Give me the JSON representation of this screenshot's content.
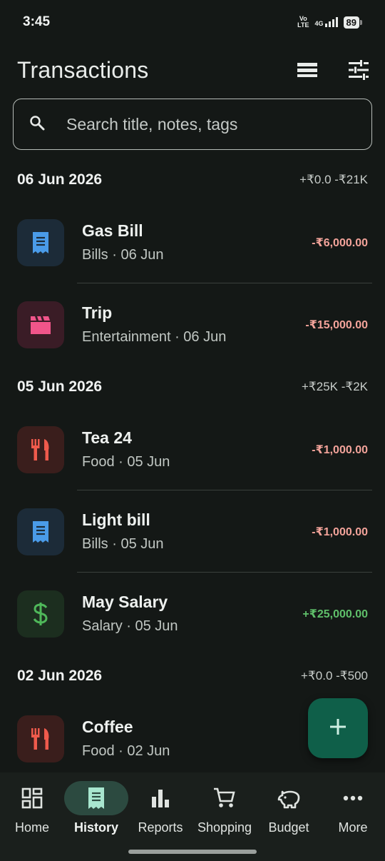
{
  "status": {
    "time": "3:45",
    "volte_top": "Vo",
    "volte_bottom": "LTE",
    "network": "4G",
    "battery": "89"
  },
  "header": {
    "title": "Transactions",
    "icons": [
      "view-list-icon",
      "filter-tune-icon"
    ]
  },
  "search": {
    "placeholder": "Search title, notes, tags",
    "value": ""
  },
  "groups": [
    {
      "date": "06 Jun 2026",
      "totals": "+₹0.0  -₹21K",
      "items": [
        {
          "title": "Gas Bill",
          "subtitle": "Bills · 06 Jun",
          "amount": "-₹6,000.00",
          "icon": "receipt-icon",
          "kind": "expense",
          "icon_color": "#4a9be8",
          "icon_bg": "#1c2b38"
        },
        {
          "title": "Trip",
          "subtitle": "Entertainment · 06 Jun",
          "amount": "-₹15,000.00",
          "icon": "clapperboard-icon",
          "kind": "expense",
          "icon_color": "#f0558a",
          "icon_bg": "#3a1c26"
        }
      ]
    },
    {
      "date": "05 Jun 2026",
      "totals": "+₹25K  -₹2K",
      "items": [
        {
          "title": "Tea 24",
          "subtitle": "Food · 05 Jun",
          "amount": "-₹1,000.00",
          "icon": "fork-knife-icon",
          "kind": "expense",
          "icon_color": "#ef5a4c",
          "icon_bg": "#3a1e1c"
        },
        {
          "title": "Light bill",
          "subtitle": "Bills · 05 Jun",
          "amount": "-₹1,000.00",
          "icon": "receipt-icon",
          "kind": "expense",
          "icon_color": "#4a9be8",
          "icon_bg": "#1c2b38"
        },
        {
          "title": "May Salary",
          "subtitle": "Salary · 05 Jun",
          "amount": "+₹25,000.00",
          "icon": "dollar-icon",
          "kind": "income",
          "icon_color": "#4fb85a",
          "icon_bg": "#1c2e1f"
        }
      ]
    },
    {
      "date": "02 Jun 2026",
      "totals": "+₹0.0  -₹500",
      "items": [
        {
          "title": "Coffee",
          "subtitle": "Food · 02 Jun",
          "amount": "",
          "icon": "fork-knife-icon",
          "kind": "expense",
          "icon_color": "#ef5a4c",
          "icon_bg": "#3a1e1c"
        }
      ]
    }
  ],
  "fab": {
    "icon": "plus-icon",
    "color": "#0f5f49"
  },
  "nav": [
    {
      "label": "Home",
      "icon": "dashboard-icon",
      "active": false
    },
    {
      "label": "History",
      "icon": "receipt-icon",
      "active": true
    },
    {
      "label": "Reports",
      "icon": "bar-chart-icon",
      "active": false
    },
    {
      "label": "Shopping",
      "icon": "cart-icon",
      "active": false
    },
    {
      "label": "Budget",
      "icon": "piggy-bank-icon",
      "active": false
    },
    {
      "label": "More",
      "icon": "more-dots-icon",
      "active": false
    }
  ]
}
